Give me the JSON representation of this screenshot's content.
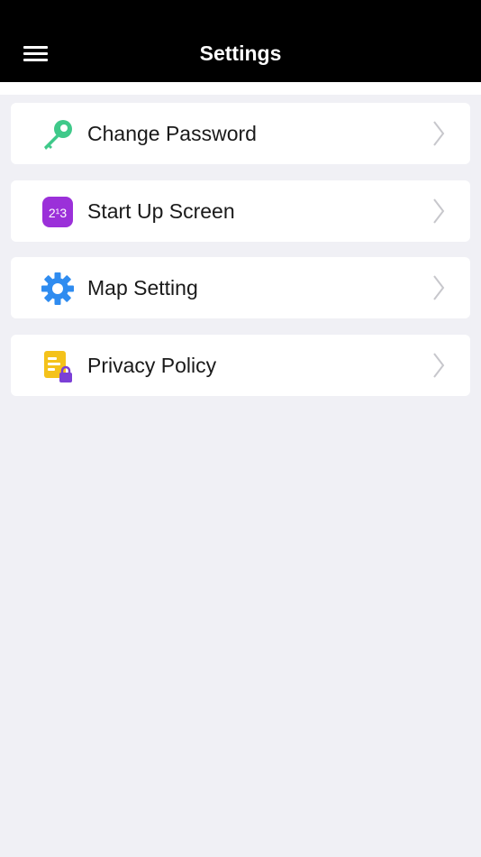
{
  "header": {
    "title": "Settings",
    "menu_icon": "hamburger-menu-icon"
  },
  "settings": {
    "items": [
      {
        "label": "Change Password",
        "icon": "key-icon",
        "icon_color": "#3fc98a"
      },
      {
        "label": "Start Up Screen",
        "icon": "numbers-icon",
        "icon_text": "2¹3",
        "icon_color": "#9b30d9"
      },
      {
        "label": "Map Setting",
        "icon": "gear-icon",
        "icon_color": "#2f8cf0"
      },
      {
        "label": "Privacy Policy",
        "icon": "document-lock-icon",
        "icon_color": "#f4c21b"
      }
    ]
  },
  "colors": {
    "header_bg": "#000000",
    "page_bg": "#f0f0f5",
    "chevron": "#c7c7cc"
  }
}
